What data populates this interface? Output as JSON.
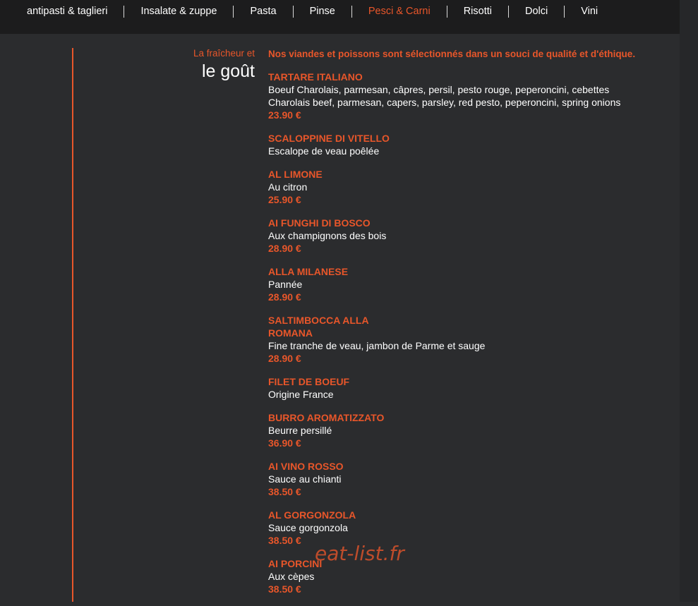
{
  "nav": {
    "items": [
      {
        "label": "antipasti & taglieri",
        "active": false
      },
      {
        "label": "Insalate & zuppe",
        "active": false
      },
      {
        "label": "Pasta",
        "active": false
      },
      {
        "label": "Pinse",
        "active": false
      },
      {
        "label": "Pesci & Carni",
        "active": true
      },
      {
        "label": "Risotti",
        "active": false
      },
      {
        "label": "Dolci",
        "active": false
      },
      {
        "label": "Vini",
        "active": false
      }
    ]
  },
  "section": {
    "subtitle": "La fraîcheur et",
    "title": "le goût"
  },
  "intro": "Nos viandes et poissons sont sélectionnés dans un souci de qualité et d'éthique.",
  "dishes": [
    {
      "name": "TARTARE ITALIANO",
      "desc": [
        "Boeuf Charolais, parmesan, câpres, persil, pesto rouge, peperoncini, cebettes",
        "Charolais beef, parmesan, capers, parsley, red pesto, peperoncini, spring onions"
      ],
      "price": "23.90 €"
    },
    {
      "name": "SCALOPPINE DI VITELLO",
      "desc": [
        "Escalope de veau poêlée"
      ],
      "price": ""
    },
    {
      "name": "AL LIMONE",
      "desc": [
        "Au citron"
      ],
      "price": "25.90 €"
    },
    {
      "name": "AI FUNGHI DI BOSCO",
      "desc": [
        "Aux champignons des bois"
      ],
      "price": "28.90 €"
    },
    {
      "name": "ALLA MILANESE",
      "desc": [
        "Pannée"
      ],
      "price": "28.90 €"
    },
    {
      "name": "SALTIMBOCCA ALLA ROMANA",
      "desc": [
        "Fine tranche de veau, jambon de Parme et sauge"
      ],
      "price": "28.90 €"
    },
    {
      "name": "FILET DE BOEUF",
      "desc": [
        "Origine France"
      ],
      "price": ""
    },
    {
      "name": "BURRO AROMATIZZATO",
      "desc": [
        "Beurre persillé"
      ],
      "price": "36.90 €"
    },
    {
      "name": "AI VINO ROSSO",
      "desc": [
        "Sauce au chianti"
      ],
      "price": "38.50 €"
    },
    {
      "name": "AL GORGONZOLA",
      "desc": [
        "Sauce gorgonzola"
      ],
      "price": "38.50 €"
    },
    {
      "name": "AI PORCINI",
      "desc": [
        "Aux cèpes"
      ],
      "price": "38.50 €"
    }
  ],
  "watermark": "eat-list.fr",
  "colors": {
    "accent": "#e8562a",
    "background": "#2b2c2e",
    "nav_background": "#1c1c1d"
  }
}
